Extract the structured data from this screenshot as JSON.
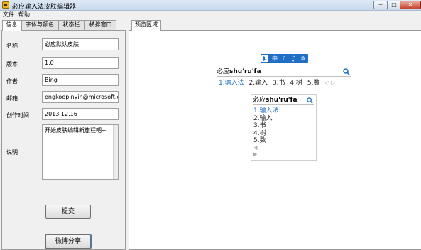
{
  "window": {
    "title": "必应输入法皮肤编辑器",
    "min_label": "─",
    "max_label": "□",
    "close_label": "✕"
  },
  "menu": {
    "items": [
      "文件",
      "帮助"
    ]
  },
  "left_tabs": [
    "信息",
    "字体与颜色",
    "状态栏",
    "横排窗口"
  ],
  "info_form": {
    "name": {
      "label": "名称",
      "value": "必应默认皮肤"
    },
    "version": {
      "label": "版本",
      "value": "1.0"
    },
    "author": {
      "label": "作者",
      "value": "Bing"
    },
    "email": {
      "label": "邮箱",
      "value": "engkoopinyin@microsoft.com"
    },
    "created": {
      "label": "创作时间",
      "value": "2013.12.16"
    },
    "description": {
      "label": "说明",
      "value": "开始皮肤编辑新旅程吧~"
    },
    "submit_label": "提交",
    "share_label": "微博分享"
  },
  "right_tabs": [
    "预览区域"
  ],
  "preview": {
    "toolbar": [
      "中",
      "☾",
      "⤸",
      "✲"
    ],
    "composition_prefix": "必应",
    "composition_pinyin": "shu'ru'fa",
    "candidates": [
      "1.输入法",
      "2.输入",
      "3.书",
      "4.树",
      "5.数"
    ],
    "h_nav": "◁ ▷",
    "v_nav_up": "◀",
    "v_nav_down": "▶"
  },
  "colors": {
    "accent": "#1e6fc5",
    "candidate_highlight": "#1f6fc6"
  },
  "icons": [
    "app-icon",
    "search-icon",
    "chinese-mode-icon",
    "moon-icon",
    "punctuation-icon",
    "settings-icon"
  ]
}
